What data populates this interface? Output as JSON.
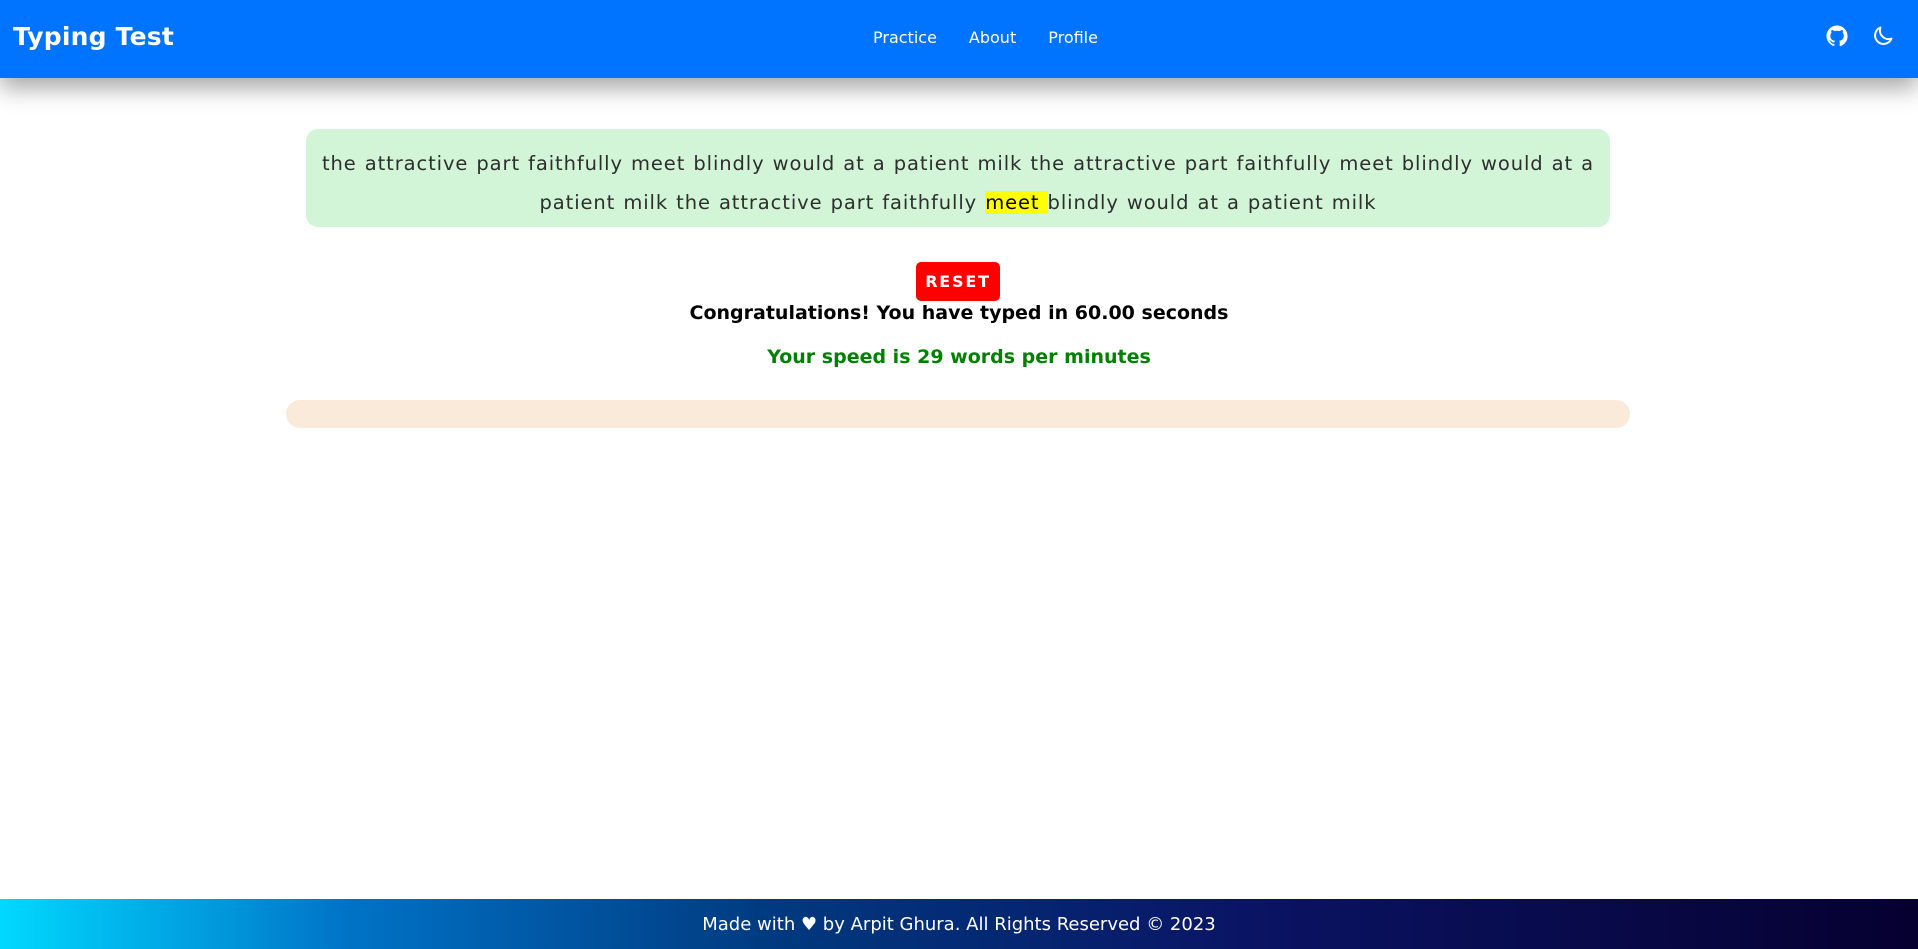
{
  "navbar": {
    "brand": "Typing Test",
    "links": [
      "Practice",
      "About",
      "Profile"
    ],
    "icons": [
      "github-icon",
      "moon-icon"
    ],
    "color": "#0073ff"
  },
  "test": {
    "text_before": "the attractive part faithfully meet blindly would at a patient milk the attractive part faithfully meet blindly would at a patient milk the attractive part faithfully ",
    "current_word": "meet ",
    "text_after": "blindly would at a patient milk",
    "reset_label": "RESET",
    "congrats": "Congratulations! You have typed in 60.00 seconds",
    "speed": "Your speed is 29 words per minutes",
    "progress_percent": 0
  },
  "footer": {
    "text": "Made with ♥ by Arpit Ghura. All Rights Reserved © 2023"
  }
}
